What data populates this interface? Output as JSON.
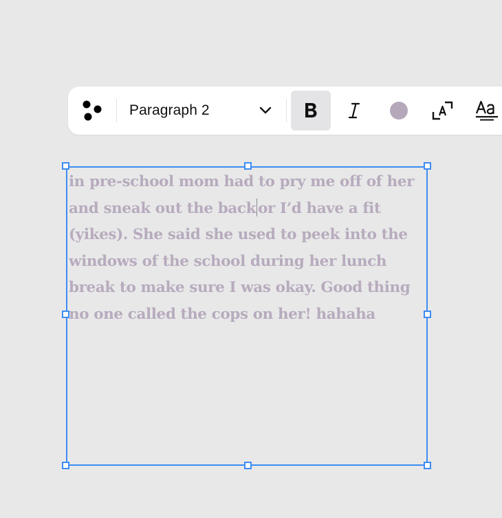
{
  "toolbar": {
    "style_label": "Paragraph 2",
    "icons": {
      "more": "dots-icon",
      "dropdown": "chevron-down-icon",
      "bold": "bold-icon",
      "italic": "italic-icon",
      "color": "text-color-icon",
      "fit": "fit-text-icon",
      "typography": "typography-icon"
    },
    "bold_active": true,
    "text_color": "#b5a8ba"
  },
  "textbox": {
    "lines": [
      "in pre-school mom had to pry me off of her",
      "and sneak out the back",
      "or I’d have a fit",
      "(yikes). She said she used to peek into the",
      "windows of the school during her lunch",
      "break to make sure I was okay. Good thing",
      "no one called the cops on her! hahaha"
    ],
    "text_color": "#b7abbd",
    "selection_color": "#3d8bf2"
  }
}
